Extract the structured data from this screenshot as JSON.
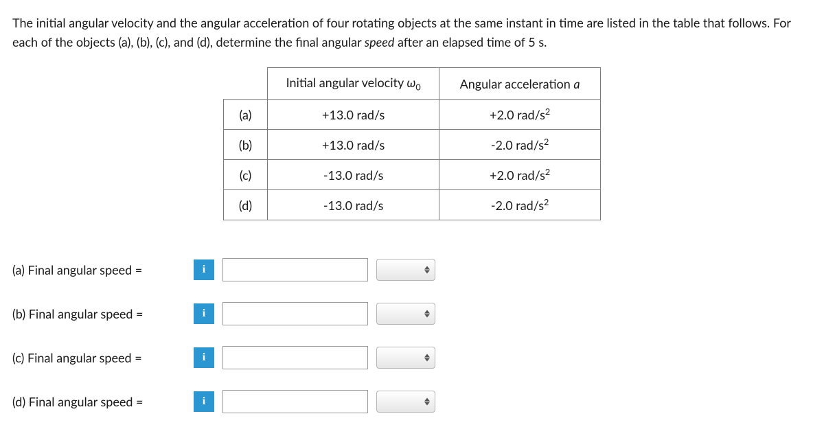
{
  "question": {
    "part1": "The initial angular velocity and the angular acceleration of four rotating objects at the same instant in time are listed in the table that follows. For each of the objects (a), (b), (c), and (d), determine the final angular ",
    "italic": "speed",
    "part2": " after an elapsed time of 5 s."
  },
  "table": {
    "col1_label_prefix": "Initial angular velocity ",
    "col1_omega": "ω",
    "col1_sub": "0",
    "col2_label_prefix": "Angular acceleration ",
    "col2_a": "a",
    "rows": [
      {
        "label": "(a)",
        "velocity": "+13.0 rad/s",
        "accel_val": "+2.0 rad/s",
        "sq": "2"
      },
      {
        "label": "(b)",
        "velocity": "+13.0 rad/s",
        "accel_val": "-2.0 rad/s",
        "sq": "2"
      },
      {
        "label": "(c)",
        "velocity": "-13.0 rad/s",
        "accel_val": "+2.0 rad/s",
        "sq": "2"
      },
      {
        "label": "(d)",
        "velocity": "-13.0 rad/s",
        "accel_val": "-2.0 rad/s",
        "sq": "2"
      }
    ]
  },
  "answers": [
    {
      "label": "(a)   Final angular speed =",
      "info": "i",
      "value": "",
      "unit": ""
    },
    {
      "label": "(b)   Final angular speed =",
      "info": "i",
      "value": "",
      "unit": ""
    },
    {
      "label": "(c)   Final angular speed =",
      "info": "i",
      "value": "",
      "unit": ""
    },
    {
      "label": "(d)   Final angular speed =",
      "info": "i",
      "value": "",
      "unit": ""
    }
  ]
}
